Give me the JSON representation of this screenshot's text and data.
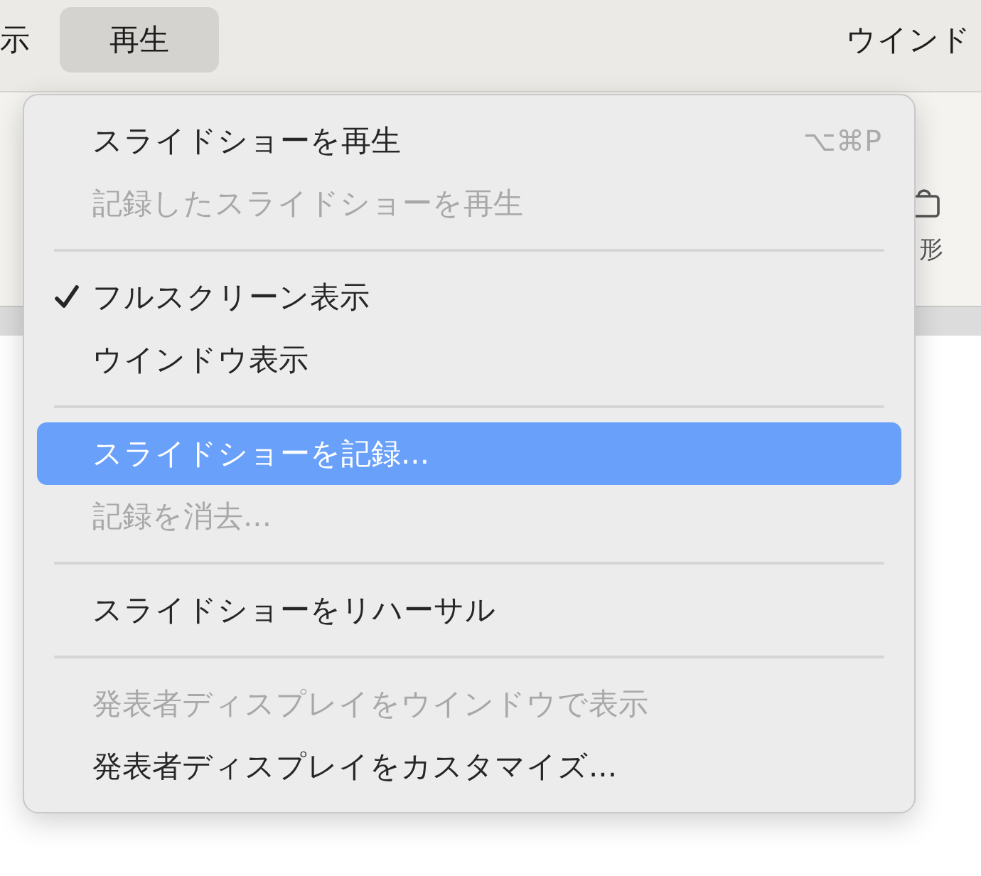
{
  "menubar": {
    "items": [
      {
        "label": "示",
        "selected": false
      },
      {
        "label": "再生",
        "selected": true
      },
      {
        "label": "ウインド",
        "selected": false
      }
    ]
  },
  "toolbar": {
    "shape_label": "形"
  },
  "menu": {
    "items": [
      {
        "kind": "item",
        "label": "スライドショーを再生",
        "shortcut": "⌥⌘P",
        "disabled": false,
        "checked": false,
        "selected": false
      },
      {
        "kind": "item",
        "label": "記録したスライドショーを再生",
        "disabled": true,
        "checked": false,
        "selected": false
      },
      {
        "kind": "separator"
      },
      {
        "kind": "item",
        "label": "フルスクリーン表示",
        "disabled": false,
        "checked": true,
        "selected": false
      },
      {
        "kind": "item",
        "label": "ウインドウ表示",
        "disabled": false,
        "checked": false,
        "selected": false
      },
      {
        "kind": "separator"
      },
      {
        "kind": "item",
        "label": "スライドショーを記録...",
        "disabled": false,
        "checked": false,
        "selected": true
      },
      {
        "kind": "item",
        "label": "記録を消去...",
        "disabled": true,
        "checked": false,
        "selected": false
      },
      {
        "kind": "separator"
      },
      {
        "kind": "item",
        "label": "スライドショーをリハーサル",
        "disabled": false,
        "checked": false,
        "selected": false
      },
      {
        "kind": "separator"
      },
      {
        "kind": "item",
        "label": "発表者ディスプレイをウインドウで表示",
        "disabled": true,
        "checked": false,
        "selected": false
      },
      {
        "kind": "item",
        "label": "発表者ディスプレイをカスタマイズ...",
        "disabled": false,
        "checked": false,
        "selected": false
      }
    ]
  }
}
